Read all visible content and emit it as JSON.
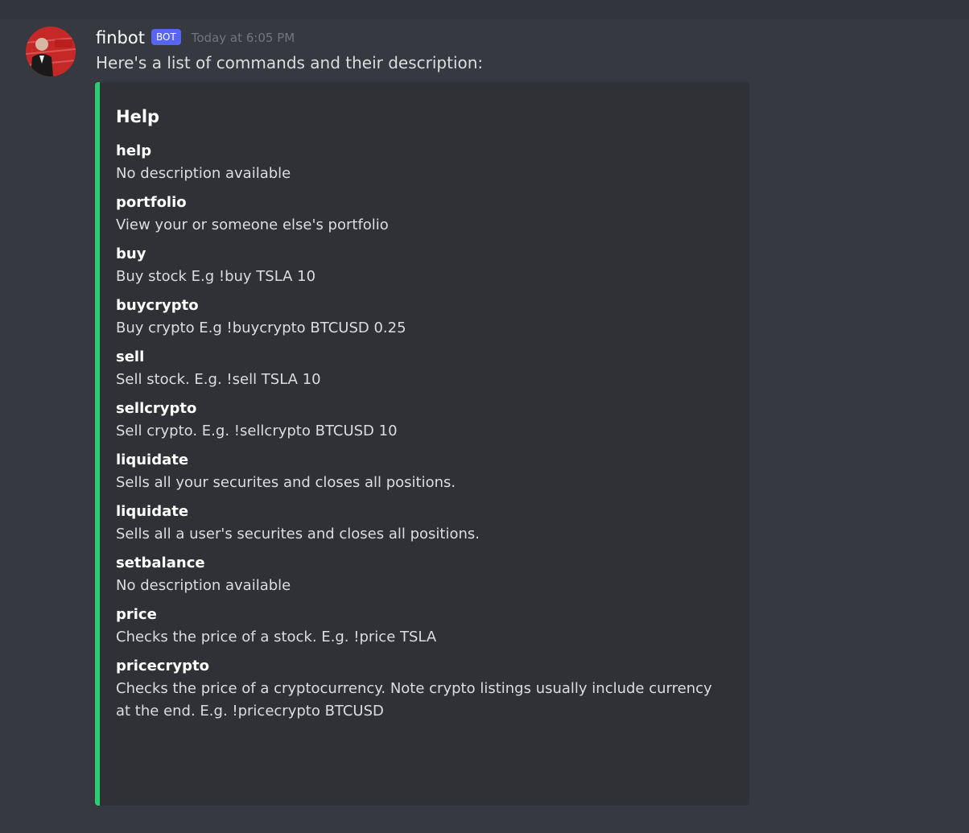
{
  "message": {
    "username": "finbot",
    "bot_tag": "BOT",
    "timestamp": "Today at 6:05 PM",
    "content": "Here's a list of commands and their description:"
  },
  "embed": {
    "accent_color": "#2ecc71",
    "title": "Help",
    "fields": [
      {
        "name": "help",
        "value": "No description available"
      },
      {
        "name": "portfolio",
        "value": "View your or someone else's portfolio"
      },
      {
        "name": "buy",
        "value": "Buy stock E.g !buy TSLA 10"
      },
      {
        "name": "buycrypto",
        "value": "Buy crypto E.g !buycrypto BTCUSD 0.25"
      },
      {
        "name": "sell",
        "value": "Sell stock. E.g. !sell TSLA 10"
      },
      {
        "name": "sellcrypto",
        "value": "Sell crypto. E.g. !sellcrypto BTCUSD 10"
      },
      {
        "name": "liquidate",
        "value": "Sells all your securites and closes all positions."
      },
      {
        "name": "liquidate",
        "value": "Sells all a user's securites and closes all positions."
      },
      {
        "name": "setbalance",
        "value": "No description available"
      },
      {
        "name": "price",
        "value": "Checks the price of a stock. E.g. !price TSLA"
      },
      {
        "name": "pricecrypto",
        "value": "Checks the price of a cryptocurrency. Note crypto listings usually include currency at the end. E.g. !pricecrypto BTCUSD"
      }
    ]
  },
  "colors": {
    "background": "#36393f",
    "embed_background": "#2f3136",
    "bot_tag": "#5865f2",
    "timestamp": "#72767d"
  },
  "icons": {
    "avatar": "bot-avatar-icon"
  }
}
